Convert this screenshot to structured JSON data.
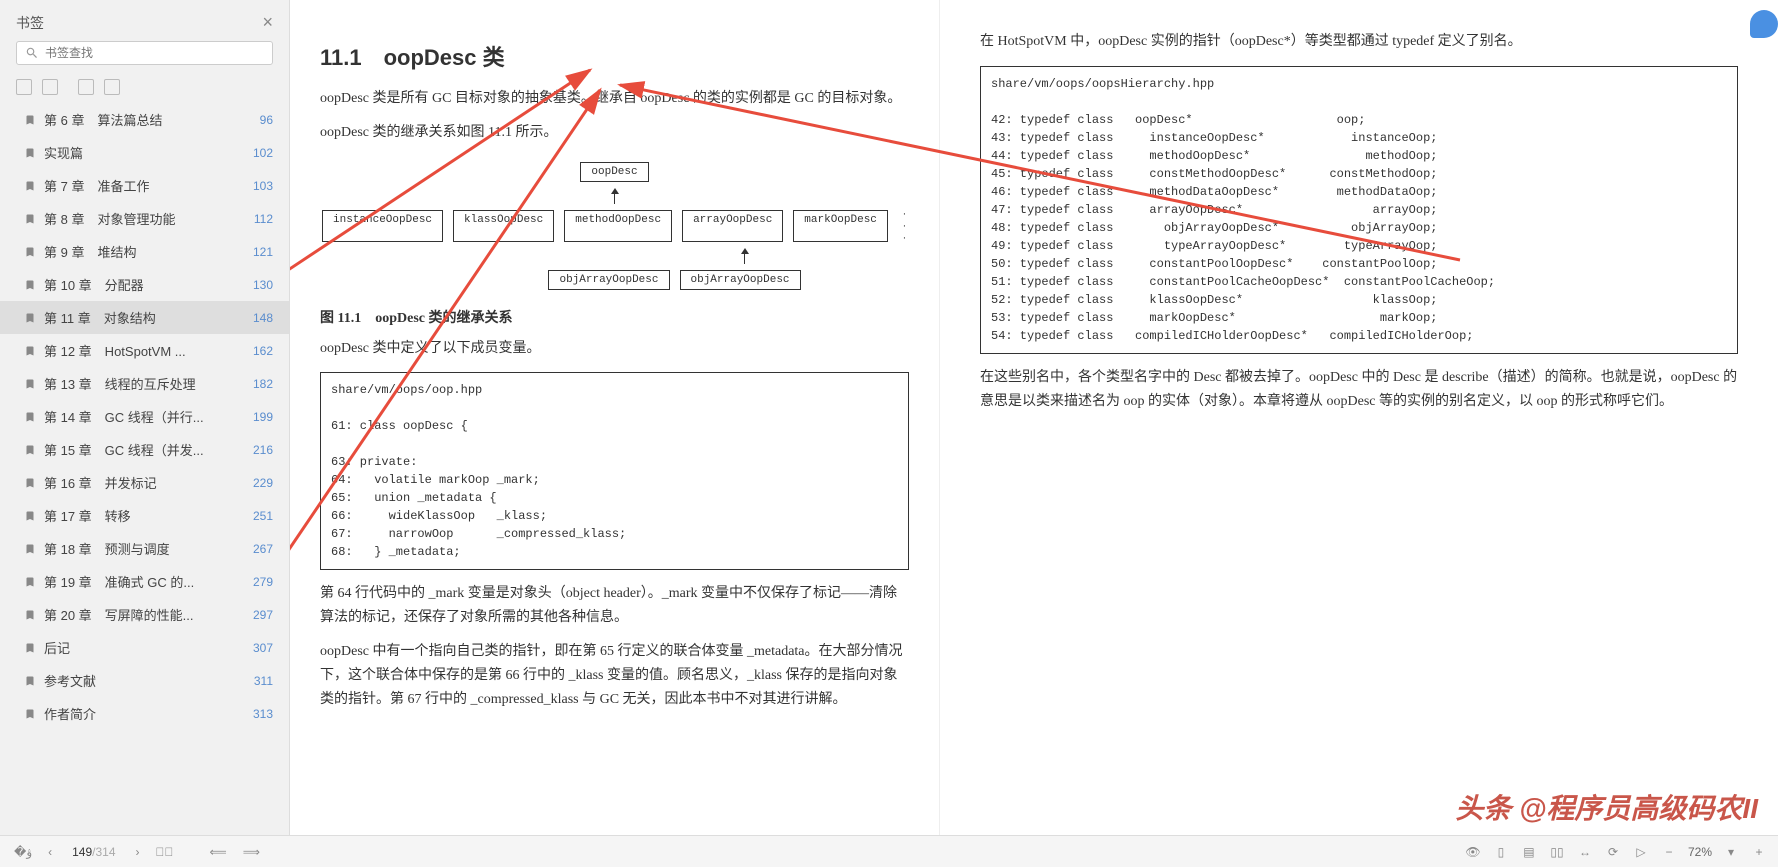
{
  "sidebar": {
    "title": "书签",
    "search_placeholder": "书签查找",
    "items": [
      {
        "label": "第 6 章　算法篇总结",
        "page": "96"
      },
      {
        "label": "实现篇",
        "page": "102"
      },
      {
        "label": "第 7 章　准备工作",
        "page": "103"
      },
      {
        "label": "第 8 章　对象管理功能",
        "page": "112"
      },
      {
        "label": "第 9 章　堆结构",
        "page": "121"
      },
      {
        "label": "第 10 章　分配器",
        "page": "130"
      },
      {
        "label": "第 11 章　对象结构",
        "page": "148",
        "selected": true
      },
      {
        "label": "第 12 章　HotSpotVM ...",
        "page": "162"
      },
      {
        "label": "第 13 章　线程的互斥处理",
        "page": "182"
      },
      {
        "label": "第 14 章　GC 线程（并行...",
        "page": "199"
      },
      {
        "label": "第 15 章　GC 线程（并发...",
        "page": "216"
      },
      {
        "label": "第 16 章　并发标记",
        "page": "229"
      },
      {
        "label": "第 17 章　转移",
        "page": "251"
      },
      {
        "label": "第 18 章　预测与调度",
        "page": "267"
      },
      {
        "label": "第 19 章　准确式 GC 的...",
        "page": "279"
      },
      {
        "label": "第 20 章　写屏障的性能...",
        "page": "297"
      },
      {
        "label": "后记",
        "page": "307"
      },
      {
        "label": "参考文献",
        "page": "311"
      },
      {
        "label": "作者简介",
        "page": "313"
      }
    ]
  },
  "leftPage": {
    "heading": "11.1　oopDesc 类",
    "p1": "oopDesc 类是所有 GC 目标对象的抽象基类。继承自 oopDesc 的类的实例都是 GC 的目标对象。",
    "p2": "oopDesc 类的继承关系如图 11.1 所示。",
    "diagram": {
      "root": "oopDesc",
      "row1": [
        "instanceOopDesc",
        "klassOopDesc",
        "methodOopDesc",
        "arrayOopDesc",
        "markOopDesc"
      ],
      "ellipsis": "· · ·",
      "row2": [
        "objArrayOopDesc",
        "objArrayOopDesc"
      ]
    },
    "figcap": "图 11.1　oopDesc 类的继承关系",
    "p3": "oopDesc 类中定义了以下成员变量。",
    "code1": "share/vm/oops/oop.hpp\n\n61: class oopDesc {\n\n63: private:\n64:   volatile markOop _mark;\n65:   union _metadata {\n66:     wideKlassOop   _klass;\n67:     narrowOop      _compressed_klass;\n68:   } _metadata;",
    "p4": "第 64 行代码中的 _mark 变量是对象头（object header）。_mark 变量中不仅保存了标记——清除算法的标记，还保存了对象所需的其他各种信息。",
    "p5": "oopDesc 中有一个指向自己类的指针，即在第 65 行定义的联合体变量 _metadata。在大部分情况下，这个联合体中保存的是第 66 行中的 _klass 变量的值。顾名思义，_klass 保存的是指向对象类的指针。第 67 行中的 _compressed_klass 与 GC 无关，因此本书中不对其进行讲解。"
  },
  "rightPage": {
    "p1": "在 HotSpotVM 中，oopDesc 实例的指针（oopDesc*）等类型都通过 typedef 定义了别名。",
    "code1": "share/vm/oops/oopsHierarchy.hpp\n\n42: typedef class   oopDesc*                    oop;\n43: typedef class     instanceOopDesc*            instanceOop;\n44: typedef class     methodOopDesc*                methodOop;\n45: typedef class     constMethodOopDesc*      constMethodOop;\n46: typedef class     methodDataOopDesc*        methodDataOop;\n47: typedef class     arrayOopDesc*                  arrayOop;\n48: typedef class       objArrayOopDesc*          objArrayOop;\n49: typedef class       typeArrayOopDesc*        typeArrayOop;\n50: typedef class     constantPoolOopDesc*    constantPoolOop;\n51: typedef class     constantPoolCacheOopDesc*  constantPoolCacheOop;\n52: typedef class     klassOopDesc*                  klassOop;\n53: typedef class     markOopDesc*                    markOop;\n54: typedef class   compiledICHolderOopDesc*   compiledICHolderOop;",
    "p2": "在这些别名中，各个类型名字中的 Desc 都被去掉了。oopDesc 中的 Desc 是 describe（描述）的简称。也就是说，oopDesc 的意思是以类来描述名为 oop 的实体（对象）。本章将遵从 oopDesc 等的实例的别名定义，以 oop 的形式称呼它们。"
  },
  "bottombar": {
    "current_page": "149",
    "total_pages": "314",
    "zoom": "72%"
  },
  "watermark": "头条 @程序员高级码农II"
}
